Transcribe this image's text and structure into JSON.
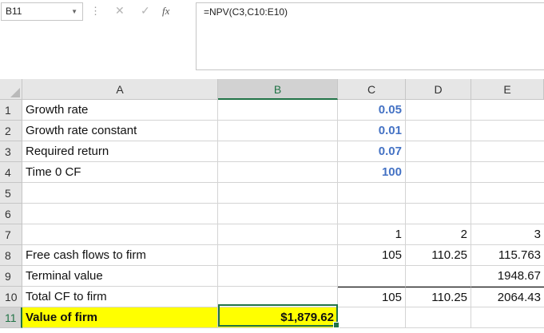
{
  "formula_bar": {
    "name_box": "B11",
    "dots": "⋮",
    "cancel_icon": "✕",
    "enter_icon": "✓",
    "fx_label": "fx",
    "formula": "=NPV(C3,C10:E10)"
  },
  "columns": [
    "A",
    "B",
    "C",
    "D",
    "E"
  ],
  "rows": [
    {
      "num": "1",
      "a": "Growth rate",
      "b": "",
      "c": "0.05",
      "d": "",
      "e": ""
    },
    {
      "num": "2",
      "a": "Growth rate constant",
      "b": "",
      "c": "0.01",
      "d": "",
      "e": ""
    },
    {
      "num": "3",
      "a": "Required return",
      "b": "",
      "c": "0.07",
      "d": "",
      "e": ""
    },
    {
      "num": "4",
      "a": "Time 0 CF",
      "b": "",
      "c": "100",
      "d": "",
      "e": ""
    },
    {
      "num": "5",
      "a": "",
      "b": "",
      "c": "",
      "d": "",
      "e": ""
    },
    {
      "num": "6",
      "a": "",
      "b": "",
      "c": "",
      "d": "",
      "e": ""
    },
    {
      "num": "7",
      "a": "",
      "b": "",
      "c": "1",
      "d": "2",
      "e": "3"
    },
    {
      "num": "8",
      "a": "Free cash flows to firm",
      "b": "",
      "c": "105",
      "d": "110.25",
      "e": "115.763"
    },
    {
      "num": "9",
      "a": "Terminal value",
      "b": "",
      "c": "",
      "d": "",
      "e": "1948.67"
    },
    {
      "num": "10",
      "a": "Total CF to firm",
      "b": "",
      "c": "105",
      "d": "110.25",
      "e": "2064.43"
    },
    {
      "num": "11",
      "a": "Value of firm",
      "b": "$1,879.62",
      "c": "",
      "d": "",
      "e": ""
    }
  ],
  "colors": {
    "accent": "#217346",
    "input_blue": "#4472c4",
    "highlight": "#ffff00"
  }
}
